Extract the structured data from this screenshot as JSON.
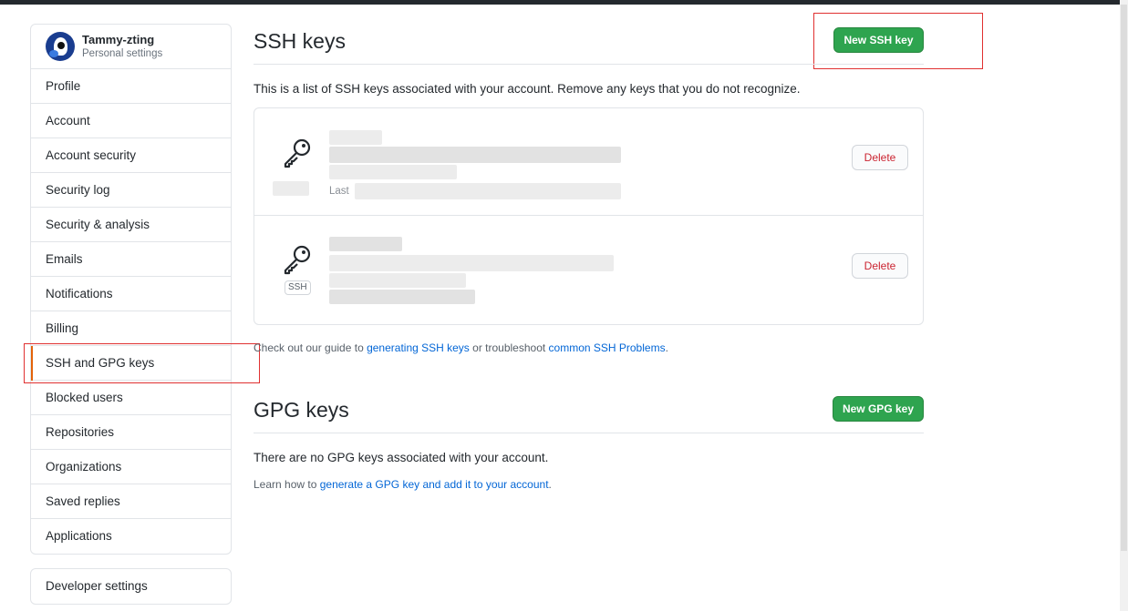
{
  "user": {
    "name": "Tammy-zting",
    "subtitle": "Personal settings"
  },
  "sidebar": {
    "items": [
      {
        "label": "Profile"
      },
      {
        "label": "Account"
      },
      {
        "label": "Account security"
      },
      {
        "label": "Security log"
      },
      {
        "label": "Security & analysis"
      },
      {
        "label": "Emails"
      },
      {
        "label": "Notifications"
      },
      {
        "label": "Billing"
      },
      {
        "label": "SSH and GPG keys"
      },
      {
        "label": "Blocked users"
      },
      {
        "label": "Repositories"
      },
      {
        "label": "Organizations"
      },
      {
        "label": "Saved replies"
      },
      {
        "label": "Applications"
      }
    ],
    "selected_index": 8,
    "developer_settings": "Developer settings"
  },
  "ssh": {
    "title": "SSH keys",
    "new_button": "New SSH key",
    "description": "This is a list of SSH keys associated with your account. Remove any keys that you do not recognize.",
    "keys": [
      {
        "delete_label": "Delete",
        "partial_text": "Last"
      },
      {
        "delete_label": "Delete",
        "badge": "SSH"
      }
    ],
    "guide": {
      "prefix": "Check out our guide to ",
      "link1": "generating SSH keys",
      "middle": " or troubleshoot ",
      "link2": "common SSH Problems",
      "suffix": "."
    }
  },
  "gpg": {
    "title": "GPG keys",
    "new_button": "New GPG key",
    "empty_text": "There are no GPG keys associated with your account.",
    "learn": {
      "prefix": "Learn how to ",
      "link": "generate a GPG key and add it to your account",
      "suffix": "."
    }
  },
  "colors": {
    "primary_green": "#2ea44f",
    "danger_red": "#cb2431",
    "link_blue": "#0366d6",
    "annotation_red": "#e03030",
    "selected_marker": "#e36209"
  },
  "icons": {
    "key": "key-icon"
  }
}
